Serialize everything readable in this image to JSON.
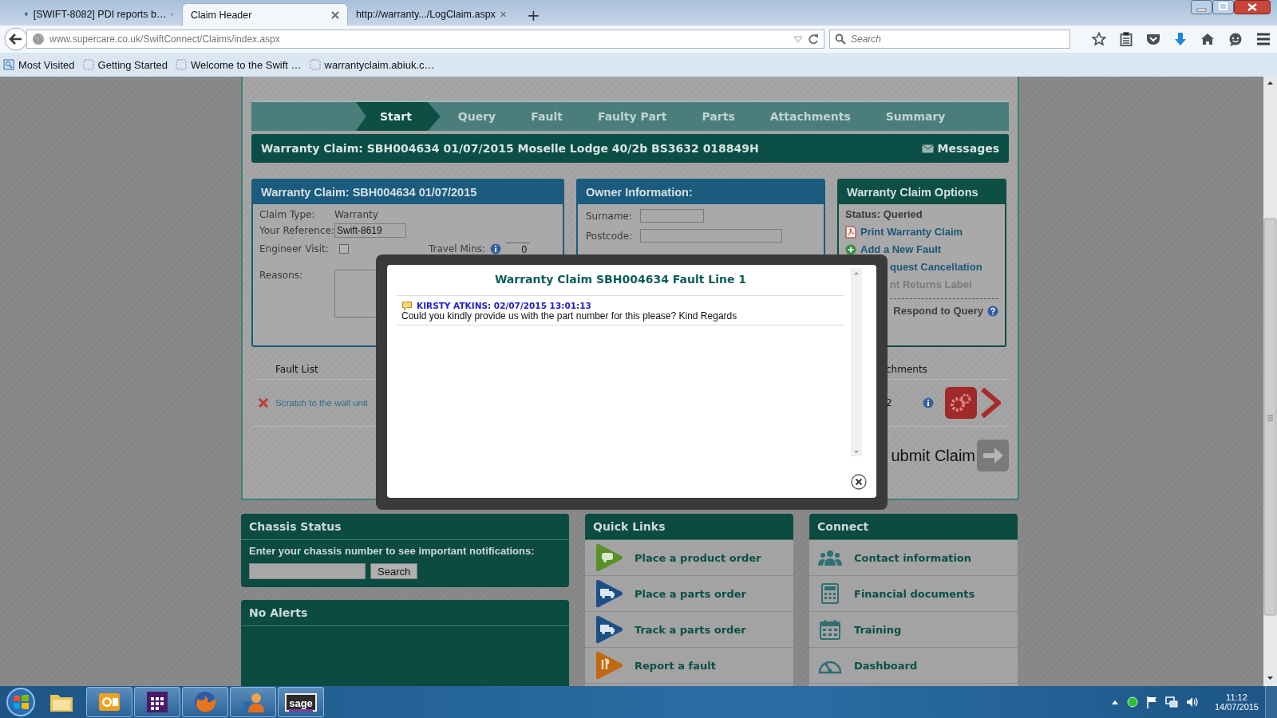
{
  "browser": {
    "tabs": [
      {
        "label": "[SWIFT-8082] PDI reports b…",
        "selected": false,
        "kind": "favicon"
      },
      {
        "label": "Claim Header",
        "selected": true,
        "kind": "plain"
      },
      {
        "label": "http://warranty.../LogClaim.aspx",
        "selected": false,
        "kind": "plain"
      }
    ],
    "new_tab": "+",
    "url": "www.supercare.co.uk/SwiftConnect/Claims/index.aspx",
    "search": {
      "placeholder": "Search"
    },
    "bookmarks": [
      {
        "label": "Most Visited",
        "kind": "folder"
      },
      {
        "label": "Getting Started",
        "kind": "page"
      },
      {
        "label": "Welcome to the Swift …",
        "kind": "page"
      },
      {
        "label": "warrantyclaim.abiuk.c…",
        "kind": "page"
      }
    ]
  },
  "wizard": {
    "steps": [
      {
        "label": "Start",
        "selected": true
      },
      {
        "label": "Query",
        "selected": false
      },
      {
        "label": "Fault",
        "selected": false
      },
      {
        "label": "Faulty Part",
        "selected": false
      },
      {
        "label": "Parts",
        "selected": false
      },
      {
        "label": "Attachments",
        "selected": false
      },
      {
        "label": "Summary",
        "selected": false
      }
    ]
  },
  "claim_header": {
    "title": "Warranty Claim: SBH004634 01/07/2015 Moselle Lodge 40/2b BS3632 018849H",
    "messages": "Messages"
  },
  "claim_panel": {
    "title": "Warranty Claim: SBH004634 01/07/2015",
    "claim_type": {
      "label": "Claim Type:",
      "value": "Warranty"
    },
    "reference": {
      "label": "Your Reference:",
      "value": "Swift-8619"
    },
    "engineer_visit": {
      "label": "Engineer Visit:",
      "checked": false
    },
    "travel_mins": {
      "label": "Travel Mins:",
      "value": "0"
    },
    "reasons": {
      "label": "Reasons:"
    }
  },
  "owner_panel": {
    "title": "Owner Information:",
    "fields": [
      {
        "label": "Surname:"
      },
      {
        "label": "Postcode:"
      }
    ]
  },
  "options_panel": {
    "title": "Warranty Claim Options",
    "items": [
      {
        "kind": "status",
        "text": "Status: Queried",
        "disabled": false
      },
      {
        "kind": "pdf",
        "text": "Print Warranty Claim",
        "disabled": false
      },
      {
        "kind": "add",
        "text": "Add a New Fault",
        "disabled": false
      },
      {
        "kind": "tail",
        "text": "quest Cancellation",
        "disabled": false
      },
      {
        "kind": "tail",
        "text": "nt Returns Label",
        "disabled": true
      },
      {
        "kind": "query",
        "text": "Respond to Query",
        "disabled": false
      }
    ]
  },
  "fault_list": {
    "columns": [
      "Fault List",
      "chments"
    ],
    "rows": [
      {
        "description": "Scratch to the wall unit",
        "attachments": "2"
      }
    ]
  },
  "submit": {
    "label": "ubmit Claim"
  },
  "dialog": {
    "title": "Warranty Claim SBH004634 Fault Line 1",
    "messages": [
      {
        "author": "KIRSTY ATKINS: 02/07/2015 13:01:13",
        "text": "Could you kindly provide us with the part number for this please? Kind Regards"
      }
    ]
  },
  "chassis": {
    "title": "Chassis Status",
    "prompt": "Enter your chassis number to see important notifications:",
    "button": "Search"
  },
  "alerts": {
    "title": "No Alerts"
  },
  "quick_links": {
    "title": "Quick Links",
    "items": [
      {
        "label": "Place a product order",
        "kind": "caravan",
        "color": "#5a8f2a"
      },
      {
        "label": "Place a parts order",
        "kind": "truck",
        "color": "#1b4f86"
      },
      {
        "label": "Track a parts order",
        "kind": "truck",
        "color": "#1b4f86"
      },
      {
        "label": "Report a fault",
        "kind": "tools",
        "color": "#c06a10"
      }
    ]
  },
  "connect": {
    "title": "Connect",
    "items": [
      {
        "label": "Contact information",
        "kind": "people"
      },
      {
        "label": "Financial documents",
        "kind": "calculator"
      },
      {
        "label": "Training",
        "kind": "calendar"
      },
      {
        "label": "Dashboard",
        "kind": "gauge"
      }
    ]
  },
  "taskbar": {
    "apps": [
      {
        "kind": "folder",
        "running": false
      },
      {
        "kind": "outlook",
        "running": true
      },
      {
        "kind": "grid",
        "running": true
      },
      {
        "kind": "firefox",
        "running": true
      },
      {
        "kind": "people",
        "running": true
      },
      {
        "kind": "sage",
        "running": true,
        "label": "sage"
      }
    ],
    "time": "11:12",
    "date": "14/07/2015"
  }
}
